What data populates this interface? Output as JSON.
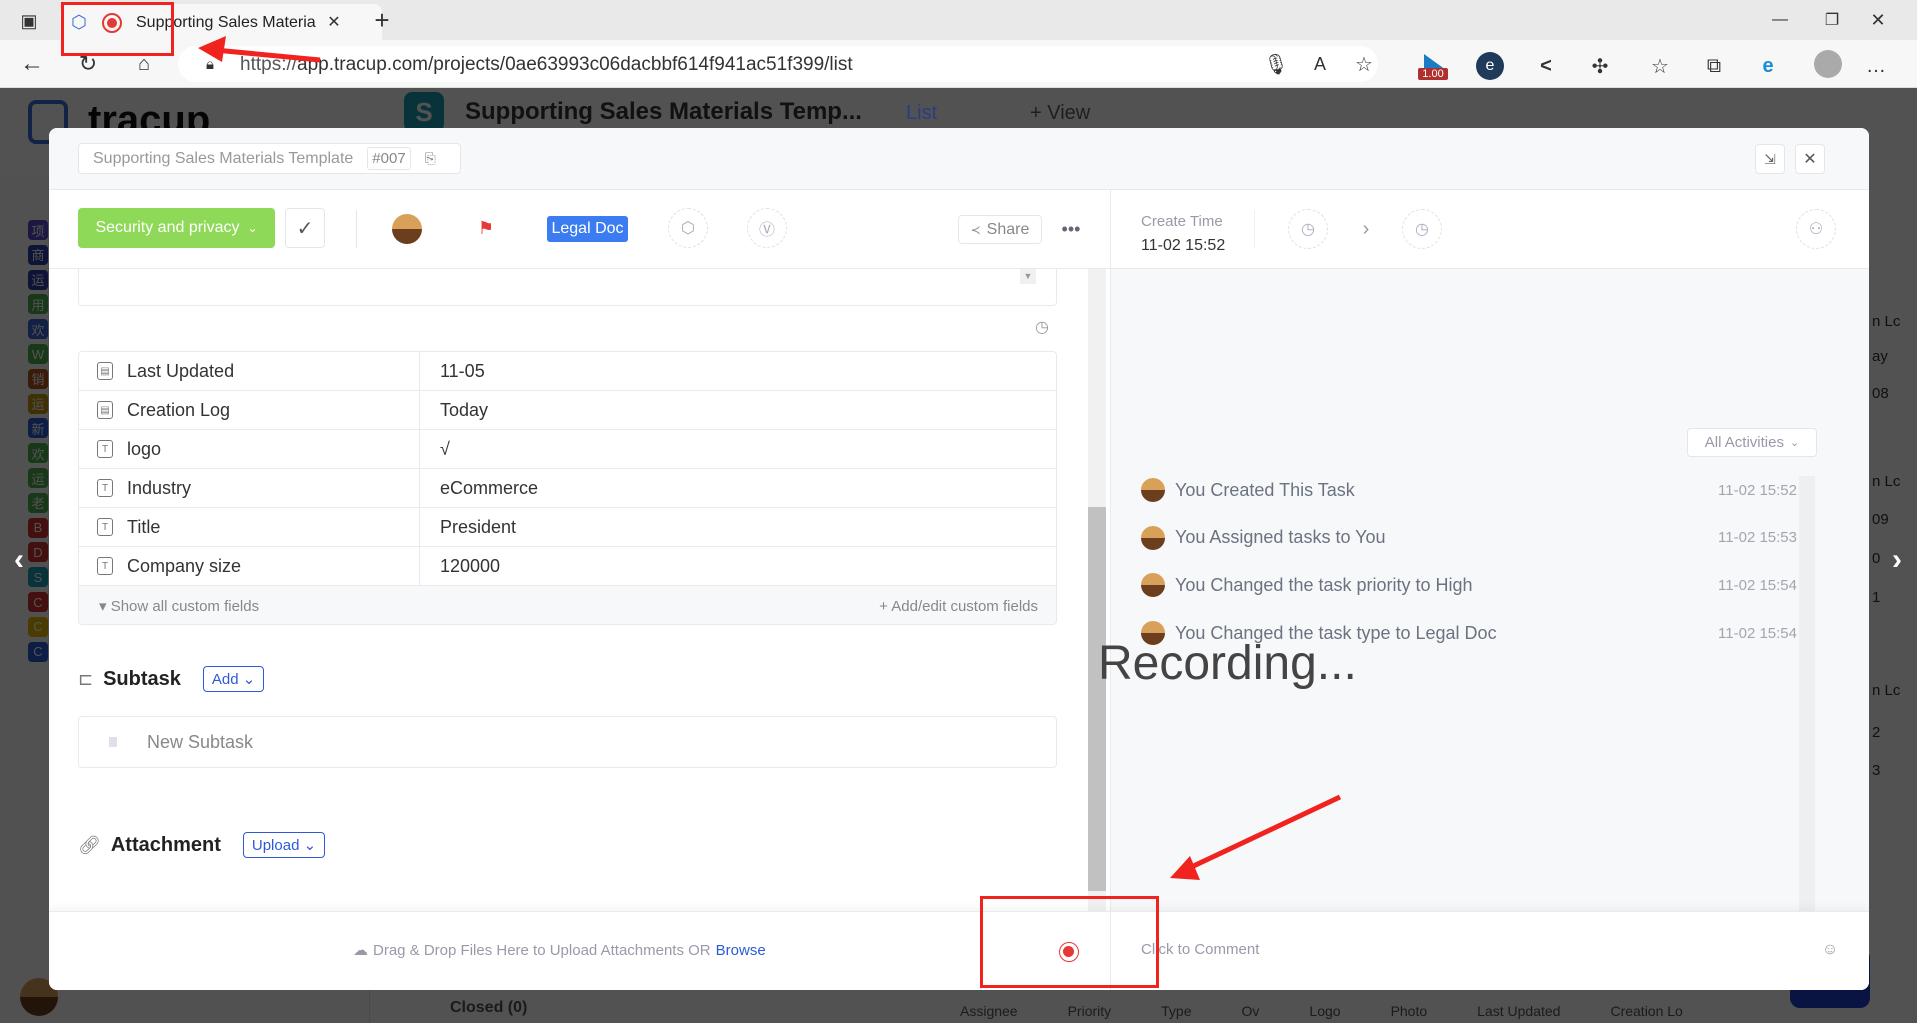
{
  "browser": {
    "tab_title": "Supporting Sales Materials",
    "url_prefix": "https://",
    "url": "app.tracup.com/projects/0ae63993c06dacbbf614f941ac51f399/list",
    "badge": "1.00",
    "icons": [
      "tab-actions-icon",
      "tracup-favicon",
      "recording-icon",
      "close-icon",
      "new-tab-icon",
      "back-icon",
      "refresh-icon",
      "home-icon",
      "lock-icon",
      "microphone-icon",
      "read-aloud-icon",
      "add-favorite-icon",
      "extension-icon",
      "share-icon",
      "puzzle-icon",
      "favorites-icon",
      "collections-icon",
      "ie-mode-icon",
      "profile-icon",
      "more-icon",
      "minimize-icon",
      "restore-icon",
      "window-close-icon"
    ]
  },
  "background": {
    "logo": "tracup",
    "project_title": "Supporting Sales Materials Temp...",
    "view_label": "List",
    "add_view": "+ View",
    "project_letter": "S",
    "sidebar": [
      {
        "ch": "项",
        "color": "#5b4bd1"
      },
      {
        "ch": "商",
        "color": "#2a3fa8"
      },
      {
        "ch": "运",
        "color": "#2a3fa8"
      },
      {
        "ch": "用",
        "color": "#4caf50"
      },
      {
        "ch": "欢",
        "color": "#3b63d8"
      },
      {
        "ch": "W",
        "color": "#4caf50"
      },
      {
        "ch": "销",
        "color": "#b5521d"
      },
      {
        "ch": "运",
        "color": "#c49a12"
      },
      {
        "ch": "新",
        "color": "#2a5bd8"
      },
      {
        "ch": "欢",
        "color": "#4caf50"
      },
      {
        "ch": "运",
        "color": "#4caf50"
      },
      {
        "ch": "老",
        "color": "#4caf50"
      },
      {
        "ch": "B",
        "color": "#d32f2f"
      },
      {
        "ch": "D",
        "color": "#d32f2f"
      },
      {
        "ch": "S",
        "color": "#1ea0b5"
      },
      {
        "ch": "C",
        "color": "#d32f2f"
      },
      {
        "ch": "C",
        "color": "#e6b800"
      },
      {
        "ch": "C",
        "color": "#2a5bd8"
      }
    ],
    "right_cells": [
      "n Lc",
      "ay",
      "08",
      "n Lc",
      "09",
      "0",
      "1",
      "n Lc",
      "2",
      "3"
    ],
    "bottom_group": "Closed (0)",
    "bottom_columns": [
      "Assignee",
      "Priority",
      "Type",
      "Ov",
      "Logo",
      "Photo",
      "Last Updated",
      "Creation Lo"
    ]
  },
  "modal": {
    "breadcrumb": "Supporting Sales Materials Template",
    "task_id": "#007",
    "status": "Security and privacy",
    "type_tag": "Legal Doc",
    "share": "Share",
    "create_time_label": "Create Time",
    "create_time": "11-02 15:52",
    "colors": {
      "status": "#8ed957",
      "type_tag": "#3b7cf0",
      "flag": "#e53935",
      "link": "#2d5bd8"
    },
    "fields": [
      {
        "icon": "calendar-icon",
        "label": "Last Updated",
        "value": "11-05"
      },
      {
        "icon": "calendar-icon",
        "label": "Creation Log",
        "value": "Today"
      },
      {
        "icon": "text-field-icon",
        "label": "logo",
        "value": "√"
      },
      {
        "icon": "text-field-icon",
        "label": "Industry",
        "value": "eCommerce"
      },
      {
        "icon": "text-field-icon",
        "label": "Title",
        "value": "President"
      },
      {
        "icon": "text-field-icon",
        "label": "Company size",
        "value": "120000"
      }
    ],
    "show_all": "Show all custom fields",
    "add_edit": "Add/edit custom fields",
    "subtask_title": "Subtask",
    "subtask_add": "Add",
    "subtask_placeholder": "New Subtask",
    "attachment_title": "Attachment",
    "upload": "Upload",
    "drop_text": "Drag & Drop Files Here to Upload Attachments OR",
    "browse": "Browse",
    "comment_placeholder": "Click to Comment",
    "activity_filter": "All Activities",
    "activities": [
      {
        "text": "You Created This Task",
        "time": "11-02 15:52"
      },
      {
        "text": "You Assigned tasks to You",
        "time": "11-02 15:53"
      },
      {
        "text": "You Changed the task priority to High",
        "time": "11-02 15:54"
      },
      {
        "text": "You Changed the task type to Legal Doc",
        "time": "11-02 15:54"
      }
    ]
  },
  "recording_text": "Recording..."
}
